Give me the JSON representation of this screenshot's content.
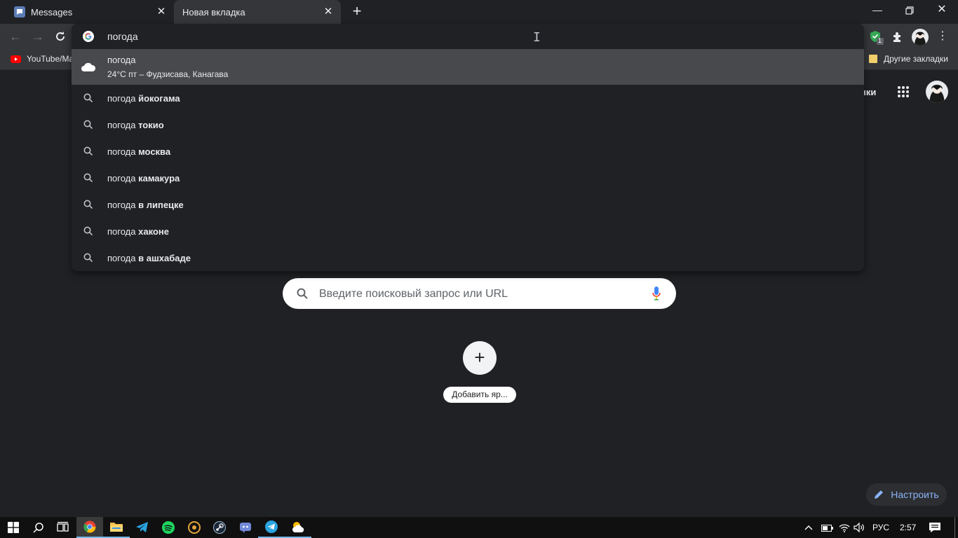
{
  "tabs": [
    {
      "title": "Messages"
    },
    {
      "title": "Новая вкладка"
    }
  ],
  "bookmarks": {
    "left": "YouTube/Ma",
    "right": "Другие закладки"
  },
  "omnibox": {
    "query": "погода",
    "weather": {
      "title": "погода",
      "details": "24°C пт – Фудзисава, Канагава"
    },
    "suggestions": [
      {
        "base": "погода ",
        "bold": "йокогама"
      },
      {
        "base": "погода ",
        "bold": "токио"
      },
      {
        "base": "погода ",
        "bold": "москва"
      },
      {
        "base": "погода ",
        "bold": "камакура"
      },
      {
        "base": "погода ",
        "bold": "в липецке"
      },
      {
        "base": "погода ",
        "bold": "хаконе"
      },
      {
        "base": "погода ",
        "bold": "в ашхабаде"
      }
    ]
  },
  "extensions": {
    "badge_count": "1"
  },
  "ntp": {
    "header_partial": "нки",
    "search_placeholder": "Введите поисковый запрос или URL",
    "add_shortcut_label": "Добавить яр...",
    "customize_label": "Настроить"
  },
  "taskbar": {
    "language": "РУС",
    "time": "2:57"
  },
  "colors": {
    "accent": "#8ab4f8",
    "chrome_dark": "#202124",
    "toolbar": "#35363a"
  }
}
